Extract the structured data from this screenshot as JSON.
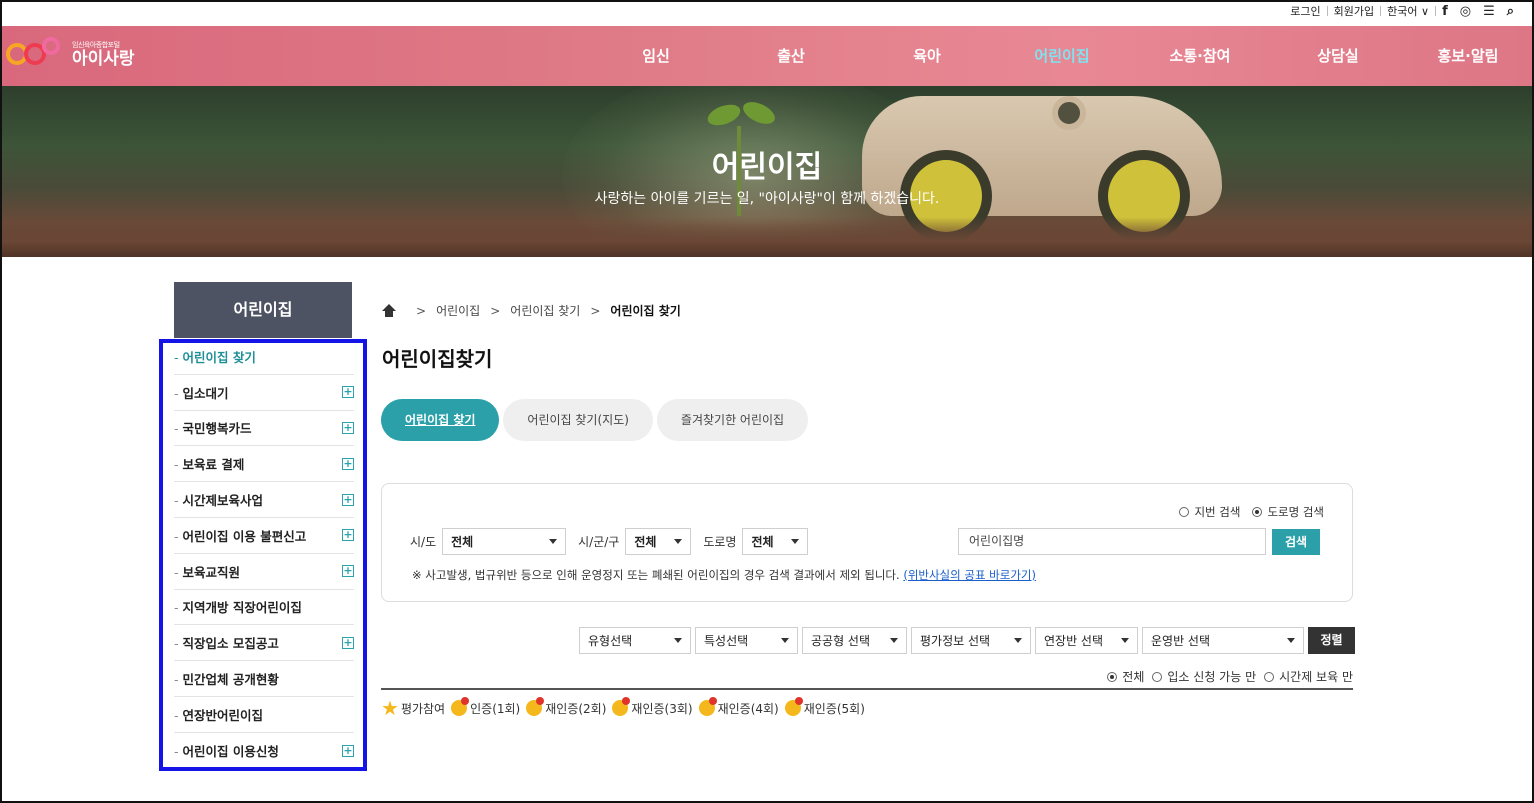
{
  "topbar": {
    "login": "로그인",
    "signup": "회원가입",
    "language": "한국어 ∨",
    "facebook_icon": "f",
    "instagram_icon": "◎",
    "menu_icon": "☰",
    "search_icon": "⌕"
  },
  "logo": {
    "subtitle": "임신육아종합포털",
    "title": "아이사랑"
  },
  "nav": [
    {
      "label": "임신"
    },
    {
      "label": "출산"
    },
    {
      "label": "육아"
    },
    {
      "label": "어린이집"
    },
    {
      "label": "소통·참여"
    },
    {
      "label": "상담실"
    },
    {
      "label": "홍보·알림"
    }
  ],
  "hero": {
    "title": "어린이집",
    "subtitle": "사랑하는 아이를 기르는 일, \"아이사랑\"이 함께 하겠습니다."
  },
  "sidebar": {
    "title": "어린이집",
    "items": [
      {
        "label": "어린이집 찾기",
        "expand": ""
      },
      {
        "label": "입소대기",
        "expand": "+"
      },
      {
        "label": "국민행복카드",
        "expand": "+"
      },
      {
        "label": "보육료 결제",
        "expand": "+"
      },
      {
        "label": "시간제보육사업",
        "expand": "+"
      },
      {
        "label": "어린이집 이용 불편신고",
        "expand": "+"
      },
      {
        "label": "보육교직원",
        "expand": "+"
      },
      {
        "label": "지역개방 직장어린이집",
        "expand": ""
      },
      {
        "label": "직장입소 모집공고",
        "expand": "+"
      },
      {
        "label": "민간업체 공개현황",
        "expand": ""
      },
      {
        "label": "연장반어린이집",
        "expand": ""
      },
      {
        "label": "어린이집 이용신청",
        "expand": "+"
      }
    ]
  },
  "breadcrumb": {
    "level1": "어린이집",
    "level2": "어린이집 찾기",
    "current": "어린이집 찾기",
    "separator": ">"
  },
  "page_title": "어린이집찾기",
  "tabs": [
    {
      "label": "어린이집 찾기"
    },
    {
      "label": "어린이집 찾기(지도)"
    },
    {
      "label": "즐겨찾기한 어린이집"
    }
  ],
  "search": {
    "mode_jibun": "지번 검색",
    "mode_road": "도로명 검색",
    "sido_label": "시/도",
    "sido_value": "전체",
    "sigungu_label": "시/군/구",
    "sigungu_value": "전체",
    "road_label": "도로명",
    "road_value": "전체",
    "name_placeholder": "어린이집명",
    "button": "검색",
    "notice": "※ 사고발생, 법규위반 등으로 인해 운영정지 또는 폐쇄된 어린이집의 경우 검색 결과에서 제외 됩니다.",
    "notice_link": "(위반사실의 공표 바로가기)"
  },
  "sort": {
    "type": "유형선택",
    "feature": "특성선택",
    "public": "공공형 선택",
    "eval": "평가정보 선택",
    "extended": "연장반 선택",
    "operation": "운영반 선택",
    "button": "정렬"
  },
  "filter": {
    "all": "전체",
    "available": "입소 신청 가능 만",
    "hourly": "시간제 보육 만"
  },
  "legend": [
    {
      "label": "평가참여"
    },
    {
      "label": "인증(1회)"
    },
    {
      "label": "재인증(2회)"
    },
    {
      "label": "재인증(3회)"
    },
    {
      "label": "재인증(4회)"
    },
    {
      "label": "재인증(5회)"
    }
  ],
  "colors": {
    "header": "#e07d88",
    "accent": "#2ba0a9",
    "nav_active": "#7fe3f0",
    "sidebar_title": "#4d5363",
    "highlight_box": "#1414e6"
  }
}
